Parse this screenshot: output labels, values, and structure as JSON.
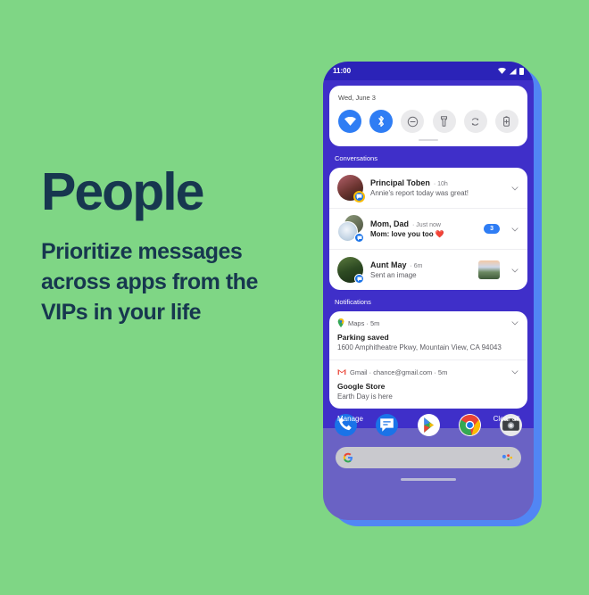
{
  "theme": {
    "background": "#7fd685",
    "text_dark": "#17374f",
    "phone_frame": "#5186f4",
    "scrim_purple": "#3f2fc9",
    "statusbar": "#2b23b8",
    "accent_blue": "#2f7df4",
    "badge_yellow": "#fbbc04"
  },
  "copy": {
    "headline": "People",
    "subhead": "Prioritize messages across apps from the VIPs in your life"
  },
  "phone": {
    "status_bar": {
      "time": "11:00",
      "icons": [
        "wifi-icon",
        "signal-icon",
        "battery-icon"
      ]
    },
    "quick_settings": {
      "date": "Wed, June 3",
      "tiles": [
        {
          "name": "wifi-toggle",
          "icon": "wifi-icon",
          "active": true
        },
        {
          "name": "bluetooth-toggle",
          "icon": "bluetooth-icon",
          "active": true
        },
        {
          "name": "do-not-disturb-toggle",
          "icon": "do-not-disturb-icon",
          "active": false
        },
        {
          "name": "flashlight-toggle",
          "icon": "flashlight-icon",
          "active": false
        },
        {
          "name": "auto-rotate-toggle",
          "icon": "auto-rotate-icon",
          "active": false
        },
        {
          "name": "battery-saver-toggle",
          "icon": "battery-saver-icon",
          "active": false
        }
      ]
    },
    "conversations": {
      "label": "Conversations",
      "items": [
        {
          "name": "Principal Toben",
          "time": "10h",
          "message": "Annie's report today was great!",
          "bold_message": false,
          "badge_app": "messages-icon",
          "badge_highlighted": true,
          "count": "",
          "has_thumbnail": false
        },
        {
          "name": "Mom, Dad",
          "time": "Just now",
          "message": "Mom: love you too ❤️",
          "bold_message": true,
          "badge_app": "messages-icon",
          "badge_highlighted": false,
          "count": "3",
          "has_thumbnail": false
        },
        {
          "name": "Aunt May",
          "time": "6m",
          "message": "Sent an image",
          "bold_message": false,
          "badge_app": "messages-icon",
          "badge_highlighted": false,
          "count": "",
          "has_thumbnail": true
        }
      ]
    },
    "notifications": {
      "label": "Notifications",
      "items": [
        {
          "app": "Maps",
          "app_icon": "maps-icon",
          "meta": "5m",
          "title": "Parking saved",
          "subtitle": "1600 Amphitheatre Pkwy, Mountain View, CA 94043"
        },
        {
          "app": "Gmail",
          "app_icon": "gmail-icon",
          "meta": "chance@gmail.com · 5m",
          "title": "Google Store",
          "subtitle": "Earth Day is here"
        }
      ]
    },
    "actions": {
      "manage_label": "Manage",
      "clear_all_label": "Clear all"
    },
    "dock": {
      "apps": [
        {
          "name": "phone-app-icon",
          "label": "Phone"
        },
        {
          "name": "messages-app-icon",
          "label": "Messages"
        },
        {
          "name": "play-store-app-icon",
          "label": "Play Store"
        },
        {
          "name": "chrome-app-icon",
          "label": "Chrome"
        },
        {
          "name": "camera-app-icon",
          "label": "Camera"
        }
      ]
    },
    "search": {
      "logo": "google-g-icon",
      "assistant": "assistant-mic-icon",
      "placeholder": ""
    }
  }
}
